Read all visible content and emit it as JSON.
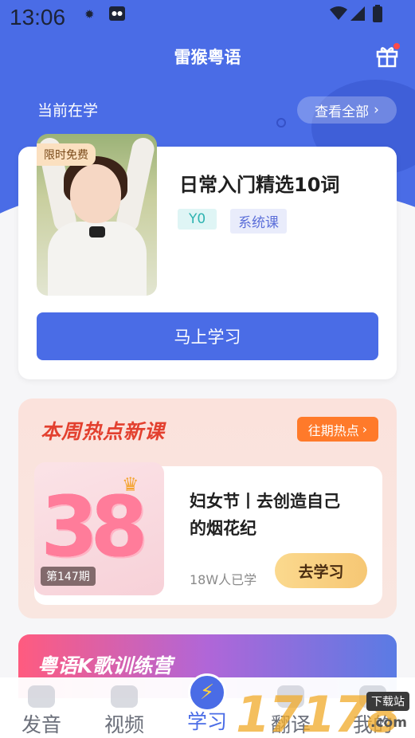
{
  "status_bar": {
    "time": "13:06"
  },
  "header": {
    "title": "雷猴粤语",
    "gift_icon": "gift-icon"
  },
  "current": {
    "label": "当前在学",
    "view_all": "查看全部",
    "course": {
      "badge": "限时免费",
      "title": "日常入门精选10词",
      "tags": [
        "Y0",
        "系统课"
      ],
      "button": "马上学习"
    }
  },
  "weekly_hot": {
    "title": "本周热点新课",
    "past_button": "往期热点",
    "item": {
      "cover_text": "38",
      "issue": "第147期",
      "title_line1": "妇女节丨去创造自己",
      "title_line2": "的烟花纪",
      "learners": "18W人已学",
      "button": "去学习"
    }
  },
  "k_song": {
    "title": "粤语K歌训练营"
  },
  "bottom_nav": {
    "items": [
      {
        "label": "发音",
        "icon": "pronunciation-icon"
      },
      {
        "label": "视频",
        "icon": "video-icon"
      },
      {
        "label": "学习",
        "icon": "lightning-icon",
        "active": true
      },
      {
        "label": "翻译",
        "icon": "translate-icon"
      },
      {
        "label": "我的",
        "icon": "profile-icon"
      }
    ]
  },
  "watermark": {
    "brand": "17178",
    "site": "下载站",
    "domain": ".com"
  },
  "colors": {
    "primary": "#4a6ce6",
    "hot": "#e3402f",
    "orange": "#ff7a2a"
  }
}
